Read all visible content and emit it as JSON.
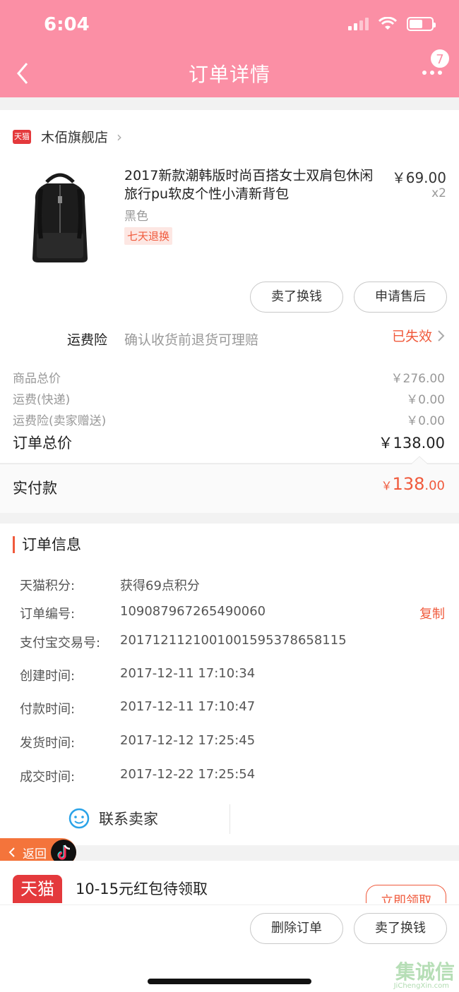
{
  "status_bar": {
    "time": "6:04"
  },
  "header": {
    "title": "订单详情",
    "badge_count": "7"
  },
  "store": {
    "logo_text": "天猫",
    "name": "木佰旗舰店"
  },
  "product": {
    "title": "2017新款潮韩版时尚百搭女士双肩包休闲旅行pu软皮个性小清新背包",
    "price": "￥69.00",
    "quantity": "x2",
    "variant": "黑色",
    "tag": "七天退换"
  },
  "actions": {
    "sell_label": "卖了换钱",
    "after_sale_label": "申请售后"
  },
  "insurance": {
    "label": "运费险",
    "description": "确认收货前退货可理赔",
    "status": "已失效"
  },
  "price_summary": {
    "rows": [
      {
        "label": "商品总价",
        "value": "￥276.00"
      },
      {
        "label": "运费(快递)",
        "value": "￥0.00"
      },
      {
        "label": "运费险(卖家赠送)",
        "value": "￥0.00"
      }
    ],
    "total_label": "订单总价",
    "total_value": "￥138.00"
  },
  "paid": {
    "label": "实付款",
    "currency": "￥",
    "integer": "138",
    "decimal": ".00"
  },
  "order_info": {
    "title": "订单信息",
    "rows": [
      {
        "label": "天猫积分:",
        "value": "获得69点积分"
      },
      {
        "label": "订单编号:",
        "value": "109087967265490060"
      },
      {
        "label": "支付宝交易号:",
        "value": "2017121121001001595378658115"
      },
      {
        "label": "创建时间:",
        "value": "2017-12-11 17:10:34"
      },
      {
        "label": "付款时间:",
        "value": "2017-12-11 17:10:47"
      },
      {
        "label": "发货时间:",
        "value": "2017-12-12 17:25:45"
      },
      {
        "label": "成交时间:",
        "value": "2017-12-22 17:25:54"
      }
    ],
    "copy_label": "复制"
  },
  "contact": {
    "label": "联系卖家"
  },
  "float_return": {
    "label": "返回"
  },
  "coupon": {
    "logo_text": "天猫",
    "text": "10-15元红包待领取",
    "button_label": "立即领取"
  },
  "bottom_bar": {
    "delete_label": "删除订单",
    "sell_label": "卖了换钱"
  },
  "watermark": {
    "text": "集诚信",
    "sub": "JiChengXin.com"
  },
  "colors": {
    "header_pink": "#fb8fa5",
    "accent_orange": "#f05a3c",
    "tmall_red": "#e4393c"
  }
}
